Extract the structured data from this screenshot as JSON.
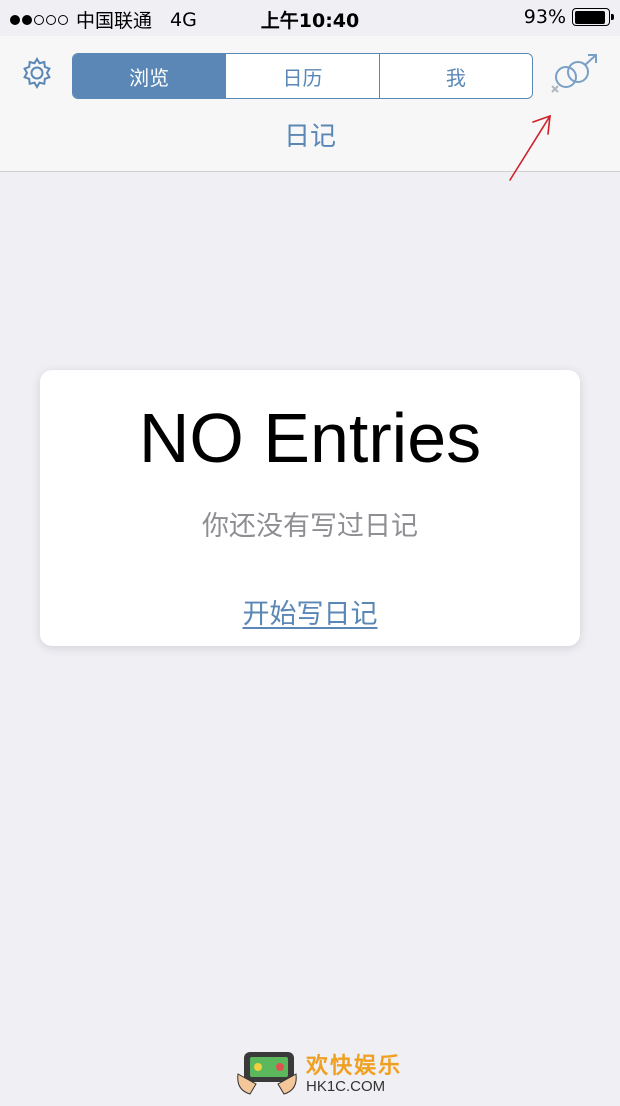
{
  "status_bar": {
    "carrier": "中国联通",
    "network": "4G",
    "time": "上午10:40",
    "battery": "93%",
    "battery_level": 0.93,
    "signal_bars": 2,
    "signal_total": 5
  },
  "nav": {
    "title": "日记",
    "tabs": [
      {
        "label": "浏览",
        "active": true
      },
      {
        "label": "日历",
        "active": false
      },
      {
        "label": "我",
        "active": false
      }
    ],
    "settings_icon": "gear-icon",
    "gender_icon": "gender-icon"
  },
  "empty_state": {
    "title": "NO Entries",
    "subtitle": "你还没有写过日记",
    "action_label": "开始写日记"
  },
  "watermark": {
    "cn_text": "欢快娱乐",
    "en_text": "HK1C.COM"
  },
  "colors": {
    "accent": "#5a87b5",
    "background": "#efeff4",
    "annotation": "#d0202a"
  }
}
